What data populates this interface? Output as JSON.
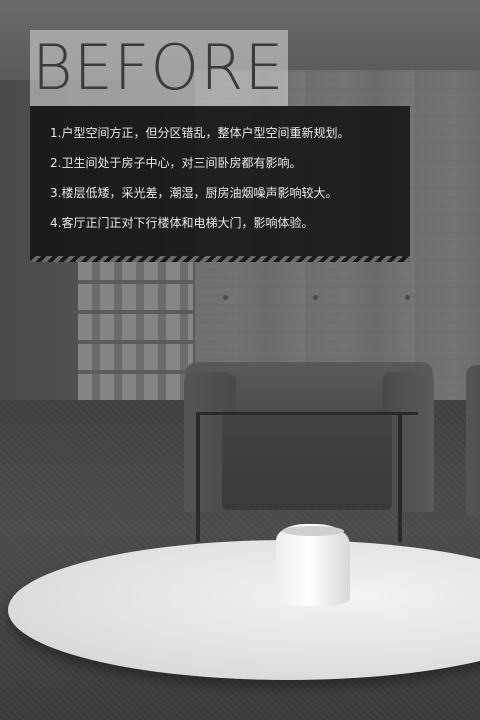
{
  "title": "BEFORE",
  "notes": [
    "1.户型空间方正，但分区错乱，整体户型空间重新规划。",
    "2.卫生间处于房子中心，对三间卧房都有影响。",
    "3.楼层低矮，采光差，潮湿，厨房油烟噪声影响较大。",
    "4.客厅正门正对下行楼体和电梯大门，影响体验。"
  ],
  "colors": {
    "panel": "#141414",
    "text": "#eaeaea",
    "title_box": "#dcdcdc"
  }
}
